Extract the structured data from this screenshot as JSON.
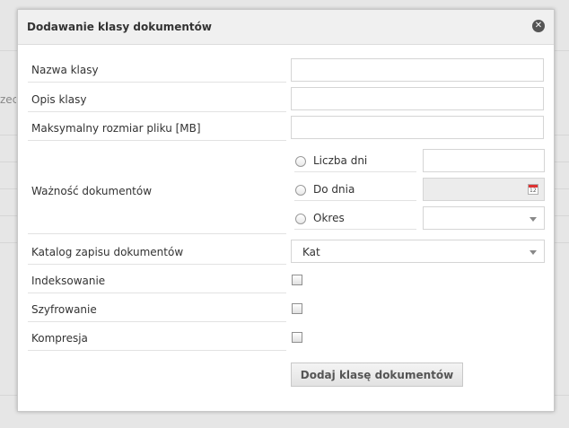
{
  "background": {
    "partial_text": "zech"
  },
  "dialog": {
    "title": "Dodawanie klasy dokumentów",
    "close_label": "✕",
    "fields": {
      "class_name_label": "Nazwa klasy",
      "class_desc_label": "Opis klasy",
      "max_size_label": "Maksymalny rozmiar pliku [MB]",
      "validity_label": "Ważność dokumentów",
      "catalog_label": "Katalog zapisu dokumentów",
      "indexing_label": "Indeksowanie",
      "encryption_label": "Szyfrowanie",
      "compression_label": "Kompresja"
    },
    "validity_options": {
      "days": "Liczba dni",
      "until_date": "Do dnia",
      "period": "Okres"
    },
    "catalog_value": "Kat",
    "submit_label": "Dodaj klasę dokumentów"
  }
}
